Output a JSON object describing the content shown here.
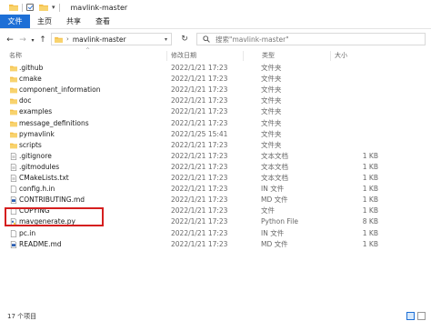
{
  "window": {
    "title": "mavlink-master"
  },
  "ribbon": {
    "tabs": [
      "文件",
      "主页",
      "共享",
      "查看"
    ]
  },
  "address": {
    "path": "mavlink-master"
  },
  "search": {
    "placeholder": "搜索\"mavlink-master\""
  },
  "columns": {
    "name": "名称",
    "date": "修改日期",
    "type": "类型",
    "size": "大小"
  },
  "files": [
    {
      "name": ".github",
      "date": "2022/1/21 17:23",
      "type": "文件夹",
      "size": "",
      "icon": "folder-icon"
    },
    {
      "name": "cmake",
      "date": "2022/1/21 17:23",
      "type": "文件夹",
      "size": "",
      "icon": "folder-icon"
    },
    {
      "name": "component_information",
      "date": "2022/1/21 17:23",
      "type": "文件夹",
      "size": "",
      "icon": "folder-icon"
    },
    {
      "name": "doc",
      "date": "2022/1/21 17:23",
      "type": "文件夹",
      "size": "",
      "icon": "folder-icon"
    },
    {
      "name": "examples",
      "date": "2022/1/21 17:23",
      "type": "文件夹",
      "size": "",
      "icon": "folder-icon"
    },
    {
      "name": "message_definitions",
      "date": "2022/1/21 17:23",
      "type": "文件夹",
      "size": "",
      "icon": "folder-icon"
    },
    {
      "name": "pymavlink",
      "date": "2022/1/25 15:41",
      "type": "文件夹",
      "size": "",
      "icon": "folder-icon"
    },
    {
      "name": "scripts",
      "date": "2022/1/21 17:23",
      "type": "文件夹",
      "size": "",
      "icon": "folder-icon"
    },
    {
      "name": ".gitignore",
      "date": "2022/1/21 17:23",
      "type": "文本文档",
      "size": "1 KB",
      "icon": "text-file-icon"
    },
    {
      "name": ".gitmodules",
      "date": "2022/1/21 17:23",
      "type": "文本文档",
      "size": "1 KB",
      "icon": "text-file-icon"
    },
    {
      "name": "CMakeLists.txt",
      "date": "2022/1/21 17:23",
      "type": "文本文档",
      "size": "1 KB",
      "icon": "text-file-icon"
    },
    {
      "name": "config.h.in",
      "date": "2022/1/21 17:23",
      "type": "IN 文件",
      "size": "1 KB",
      "icon": "file-icon"
    },
    {
      "name": "CONTRIBUTING.md",
      "date": "2022/1/21 17:23",
      "type": "MD 文件",
      "size": "1 KB",
      "icon": "md-file-icon"
    },
    {
      "name": "COPYING",
      "date": "2022/1/21 17:23",
      "type": "文件",
      "size": "1 KB",
      "icon": "file-icon"
    },
    {
      "name": "mavgenerate.py",
      "date": "2022/1/21 17:23",
      "type": "Python File",
      "size": "8 KB",
      "icon": "python-file-icon"
    },
    {
      "name": "pc.in",
      "date": "2022/1/21 17:23",
      "type": "IN 文件",
      "size": "1 KB",
      "icon": "file-icon"
    },
    {
      "name": "README.md",
      "date": "2022/1/21 17:23",
      "type": "MD 文件",
      "size": "1 KB",
      "icon": "md-file-icon"
    }
  ],
  "status": {
    "count": "17 个项目"
  },
  "colors": {
    "accent": "#1d6fd6",
    "folder": "#f5c04a",
    "highlight": "#d51f1f"
  }
}
